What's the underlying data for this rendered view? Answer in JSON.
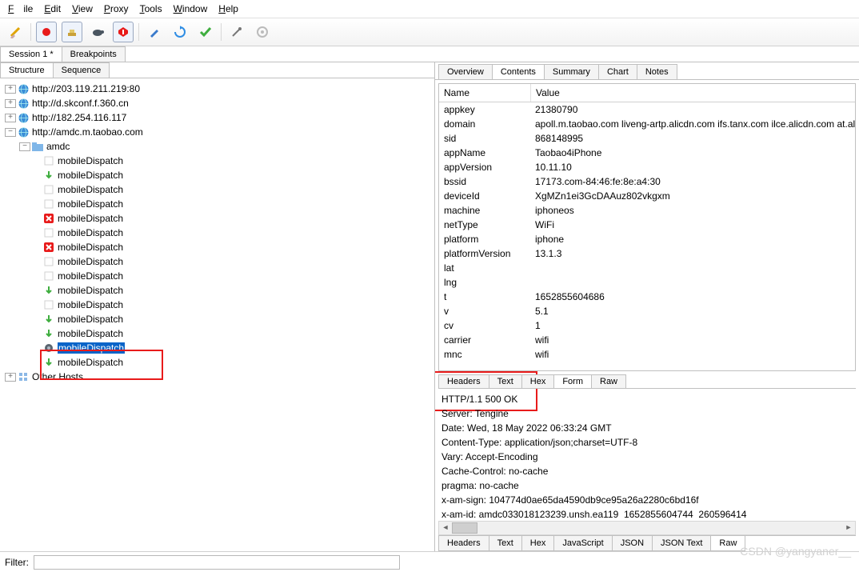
{
  "menu": {
    "file": "File",
    "edit": "Edit",
    "view": "View",
    "proxy": "Proxy",
    "tools": "Tools",
    "window": "Window",
    "help": "Help"
  },
  "session_tabs": {
    "session": "Session 1 *",
    "breakpoints": "Breakpoints"
  },
  "left_tabs": {
    "structure": "Structure",
    "sequence": "Sequence"
  },
  "tree": {
    "hosts": [
      {
        "exp": "+",
        "icon": "globe",
        "label": "http://203.119.211.219:80"
      },
      {
        "exp": "+",
        "icon": "globe",
        "label": "http://d.skconf.f.360.cn"
      },
      {
        "exp": "+",
        "icon": "globe",
        "label": "http://182.254.116.117"
      },
      {
        "exp": "-",
        "icon": "globe",
        "label": "http://amdc.m.taobao.com"
      }
    ],
    "folder": "amdc",
    "items": [
      {
        "icon": "blank",
        "label": "mobileDispatch"
      },
      {
        "icon": "down",
        "label": "mobileDispatch"
      },
      {
        "icon": "blank",
        "label": "mobileDispatch"
      },
      {
        "icon": "blank",
        "label": "mobileDispatch"
      },
      {
        "icon": "fail",
        "label": "mobileDispatch"
      },
      {
        "icon": "blank",
        "label": "mobileDispatch"
      },
      {
        "icon": "fail",
        "label": "mobileDispatch"
      },
      {
        "icon": "blank",
        "label": "mobileDispatch"
      },
      {
        "icon": "blank",
        "label": "mobileDispatch"
      },
      {
        "icon": "down",
        "label": "mobileDispatch"
      },
      {
        "icon": "blank",
        "label": "mobileDispatch"
      },
      {
        "icon": "down",
        "label": "mobileDispatch"
      },
      {
        "icon": "down",
        "label": "mobileDispatch"
      },
      {
        "icon": "wait",
        "label": "mobileDispatch",
        "selected": true
      },
      {
        "icon": "down",
        "label": "mobileDispatch"
      }
    ],
    "other": "Other Hosts"
  },
  "right_tabs": {
    "overview": "Overview",
    "contents": "Contents",
    "summary": "Summary",
    "chart": "Chart",
    "notes": "Notes"
  },
  "kv": {
    "head_name": "Name",
    "head_value": "Value",
    "rows": [
      {
        "k": "appkey",
        "v": "21380790"
      },
      {
        "k": "domain",
        "v": "apoll.m.taobao.com liveng-artp.alicdn.com ifs.tanx.com ilce.alicdn.com at.alicdn"
      },
      {
        "k": "sid",
        "v": "868148995"
      },
      {
        "k": "appName",
        "v": "Taobao4iPhone"
      },
      {
        "k": "appVersion",
        "v": "10.11.10"
      },
      {
        "k": "bssid",
        "v": "17173.com-84:46:fe:8e:a4:30"
      },
      {
        "k": "deviceId",
        "v": "XgMZn1ei3GcDAAuz802vkgxm"
      },
      {
        "k": "machine",
        "v": "iphoneos"
      },
      {
        "k": "netType",
        "v": "WiFi"
      },
      {
        "k": "platform",
        "v": "iphone"
      },
      {
        "k": "platformVersion",
        "v": "13.1.3"
      },
      {
        "k": "lat",
        "v": ""
      },
      {
        "k": "lng",
        "v": ""
      },
      {
        "k": "t",
        "v": "1652855604686"
      },
      {
        "k": "v",
        "v": "5.1"
      },
      {
        "k": "cv",
        "v": "1"
      },
      {
        "k": "carrier",
        "v": "wifi"
      },
      {
        "k": "mnc",
        "v": "wifi"
      }
    ]
  },
  "mid_tabs": {
    "headers": "Headers",
    "text": "Text",
    "hex": "Hex",
    "form": "Form",
    "raw": "Raw"
  },
  "response": {
    "lines": [
      "HTTP/1.1 500 OK",
      "Server: Tengine",
      "Date: Wed, 18 May 2022 06:33:24 GMT",
      "Content-Type: application/json;charset=UTF-8",
      "Vary: Accept-Encoding",
      "Cache-Control: no-cache",
      "pragma: no-cache",
      "x-am-sign: 104774d0ae65da4590db9ce95a26a2280c6bd16f",
      "x-am-id: amdc033018123239.unsh.ea119_1652855604744_260596414"
    ]
  },
  "bottom_tabs": {
    "headers": "Headers",
    "text": "Text",
    "hex": "Hex",
    "javascript": "JavaScript",
    "json": "JSON",
    "jsontext": "JSON Text",
    "raw": "Raw"
  },
  "filter_label": "Filter:",
  "watermark": "CSDN @yangyaner__"
}
